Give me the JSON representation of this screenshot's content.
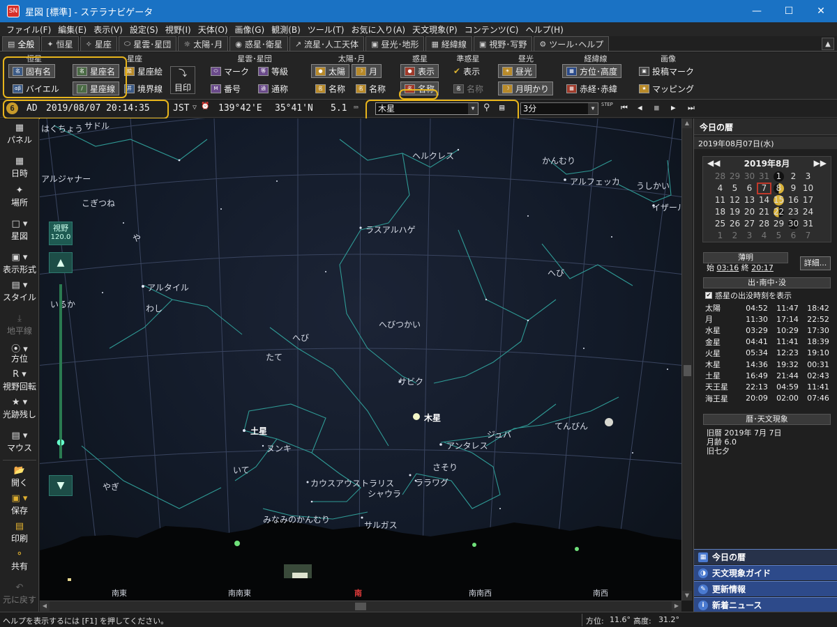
{
  "window": {
    "title": "星図 [標準] - ステラナビゲータ",
    "app_icon": "SN"
  },
  "menu": [
    "ファイル(F)",
    "編集(E)",
    "表示(V)",
    "設定(S)",
    "視野(I)",
    "天体(O)",
    "画像(G)",
    "観測(B)",
    "ツール(T)",
    "お気に入り(A)",
    "天文現象(P)",
    "コンテンツ(C)",
    "ヘルプ(H)"
  ],
  "tabs": [
    {
      "label": "全般",
      "icon": "panel-icon",
      "active": true
    },
    {
      "label": "恒星",
      "icon": "star-icon"
    },
    {
      "label": "星座",
      "icon": "constellation-icon"
    },
    {
      "label": "星雲･星団",
      "icon": "nebula-icon"
    },
    {
      "label": "太陽･月",
      "icon": "sun-icon"
    },
    {
      "label": "惑星･衛星",
      "icon": "planet-icon"
    },
    {
      "label": "流星･人工天体",
      "icon": "meteor-icon"
    },
    {
      "label": "昼光･地形",
      "icon": "landscape-icon"
    },
    {
      "label": "経緯線",
      "icon": "grid-icon"
    },
    {
      "label": "視野･写野",
      "icon": "camera-icon"
    },
    {
      "label": "ツール･ヘルプ",
      "icon": "gear-icon"
    }
  ],
  "ribbon": {
    "star": {
      "title": "恒星",
      "proper_name": "固有名",
      "bayer": "バイエル"
    },
    "constellation": {
      "title": "星座",
      "name": "星座名",
      "lines": "星座線",
      "art": "星座絵",
      "boundary": "境界線",
      "mark": "目印"
    },
    "nebula": {
      "title": "星雲･星団",
      "mark": "マーク",
      "grade": "等級",
      "number": "番号",
      "common": "通称"
    },
    "sunmoon": {
      "title": "太陽･月",
      "sun": "太陽",
      "moon": "月",
      "sun_name": "名称",
      "moon_name": "名称"
    },
    "planet": {
      "title": "惑星",
      "show": "表示",
      "name": "名称"
    },
    "minor": {
      "title": "準惑星",
      "show": "表示",
      "name": "名称"
    },
    "daylight": {
      "title": "昼光",
      "daylight": "昼光",
      "moonlight": "月明かり"
    },
    "gridlines": {
      "title": "経緯線",
      "altaz": "方位･高度",
      "radec": "赤経･赤緯"
    },
    "image": {
      "title": "画像",
      "post": "投稿マーク",
      "mapping": "マッピング"
    }
  },
  "infobar": {
    "era": "AD",
    "datetime": "2019/08/07 20:14:35",
    "tz": "JST",
    "lon": "139°42'E",
    "lat": "35°41'N",
    "mag": "5.1",
    "search_value": "木星",
    "interval": "3分",
    "step_label": "STEP"
  },
  "left_panel": [
    {
      "label": "パネル",
      "icon": "panel-icon"
    },
    {
      "label": "日時",
      "icon": "calendar-icon"
    },
    {
      "label": "場所",
      "icon": "location-icon"
    },
    {
      "label": "星図",
      "icon": "starmap-icon"
    },
    {
      "label": "表示形式",
      "icon": "display-icon"
    },
    {
      "label": "スタイル",
      "icon": "style-icon"
    },
    {
      "label": "地平線",
      "icon": "horizon-icon",
      "disabled": true
    },
    {
      "label": "方位",
      "icon": "compass-icon"
    },
    {
      "label": "視野回転",
      "icon": "rotate-icon"
    },
    {
      "label": "光跡残し",
      "icon": "trail-icon"
    },
    {
      "label": "マウス",
      "icon": "mouse-icon"
    },
    {
      "label": "開く",
      "icon": "folder-icon"
    },
    {
      "label": "保存",
      "icon": "save-icon"
    },
    {
      "label": "印刷",
      "icon": "print-icon"
    },
    {
      "label": "共有",
      "icon": "share-icon"
    },
    {
      "label": "元に戻す",
      "icon": "undo-icon",
      "disabled": true
    }
  ],
  "zoom": {
    "label": "視野",
    "value": "120.0"
  },
  "sky_labels": [
    {
      "t": "はくちょう"
    },
    {
      "t": "サドル"
    },
    {
      "t": "アルジャナー"
    },
    {
      "t": "こぎつね"
    },
    {
      "t": "や"
    },
    {
      "t": "アルタイル"
    },
    {
      "t": "わし"
    },
    {
      "t": "いるか"
    },
    {
      "t": "ヘルクレス"
    },
    {
      "t": "かんむり"
    },
    {
      "t": "アルフェッカ"
    },
    {
      "t": "うしかい"
    },
    {
      "t": "イザール"
    },
    {
      "t": "ラスアルハゲ"
    },
    {
      "t": "へび"
    },
    {
      "t": "へびつかい"
    },
    {
      "t": "へび"
    },
    {
      "t": "たて"
    },
    {
      "t": "サビク"
    },
    {
      "t": "木星",
      "bright": true
    },
    {
      "t": "土星",
      "bright": true
    },
    {
      "t": "ヌンキ"
    },
    {
      "t": "てんびん"
    },
    {
      "t": "アンタレス"
    },
    {
      "t": "ジュバ"
    },
    {
      "t": "いて"
    },
    {
      "t": "さそり"
    },
    {
      "t": "やぎ"
    },
    {
      "t": "カウスアウストラリス"
    },
    {
      "t": "ララワグ"
    },
    {
      "t": "シャウラ"
    },
    {
      "t": "みなみのかんむり"
    },
    {
      "t": "サルガス"
    }
  ],
  "directions": [
    "南東",
    "南南東",
    "南",
    "南南西",
    "南西"
  ],
  "right_panel": {
    "header": "今日の暦",
    "date": "2019年08月07日(水)",
    "calendar": {
      "month": "2019年8月",
      "rows": [
        [
          "28",
          "29",
          "30",
          "31",
          "1",
          "2",
          "3"
        ],
        [
          "4",
          "5",
          "6",
          "7",
          "8",
          "9",
          "10"
        ],
        [
          "11",
          "12",
          "13",
          "14",
          "15",
          "16",
          "17"
        ],
        [
          "18",
          "19",
          "20",
          "21",
          "22",
          "23",
          "24"
        ],
        [
          "25",
          "26",
          "27",
          "28",
          "29",
          "30",
          "31"
        ],
        [
          "1",
          "2",
          "3",
          "4",
          "5",
          "6",
          "7"
        ]
      ],
      "selected": "7"
    },
    "twilight": {
      "title": "薄明",
      "start_label": "始",
      "start": "03:16",
      "end_label": "終",
      "end": "20:17",
      "detail": "詳細..."
    },
    "rise_set": {
      "title": "出･南中･没",
      "checkbox": "惑星の出没時刻を表示",
      "rows": [
        [
          "太陽",
          "04:52",
          "11:47",
          "18:42"
        ],
        [
          "月",
          "11:30",
          "17:14",
          "22:52"
        ],
        [
          "水星",
          "03:29",
          "10:29",
          "17:30"
        ],
        [
          "金星",
          "04:41",
          "11:41",
          "18:39"
        ],
        [
          "火星",
          "05:34",
          "12:23",
          "19:10"
        ],
        [
          "木星",
          "14:36",
          "19:32",
          "00:31"
        ],
        [
          "土星",
          "16:49",
          "21:44",
          "02:43"
        ],
        [
          "天王星",
          "22:13",
          "04:59",
          "11:41"
        ],
        [
          "海王星",
          "20:09",
          "02:00",
          "07:46"
        ]
      ]
    },
    "events": {
      "title": "暦･天文現象",
      "lines": [
        "旧暦 2019年 7月 7日",
        "月齢 6.0",
        "旧七夕"
      ]
    },
    "nav": [
      "今日の暦",
      "天文現象ガイド",
      "更新情報",
      "新着ニュース"
    ]
  },
  "status": {
    "help": "ヘルプを表示するには [F1] を押してください。",
    "az_label": "方位:",
    "az": "11.6°",
    "alt_label": "高度:",
    "alt": "31.2°"
  }
}
